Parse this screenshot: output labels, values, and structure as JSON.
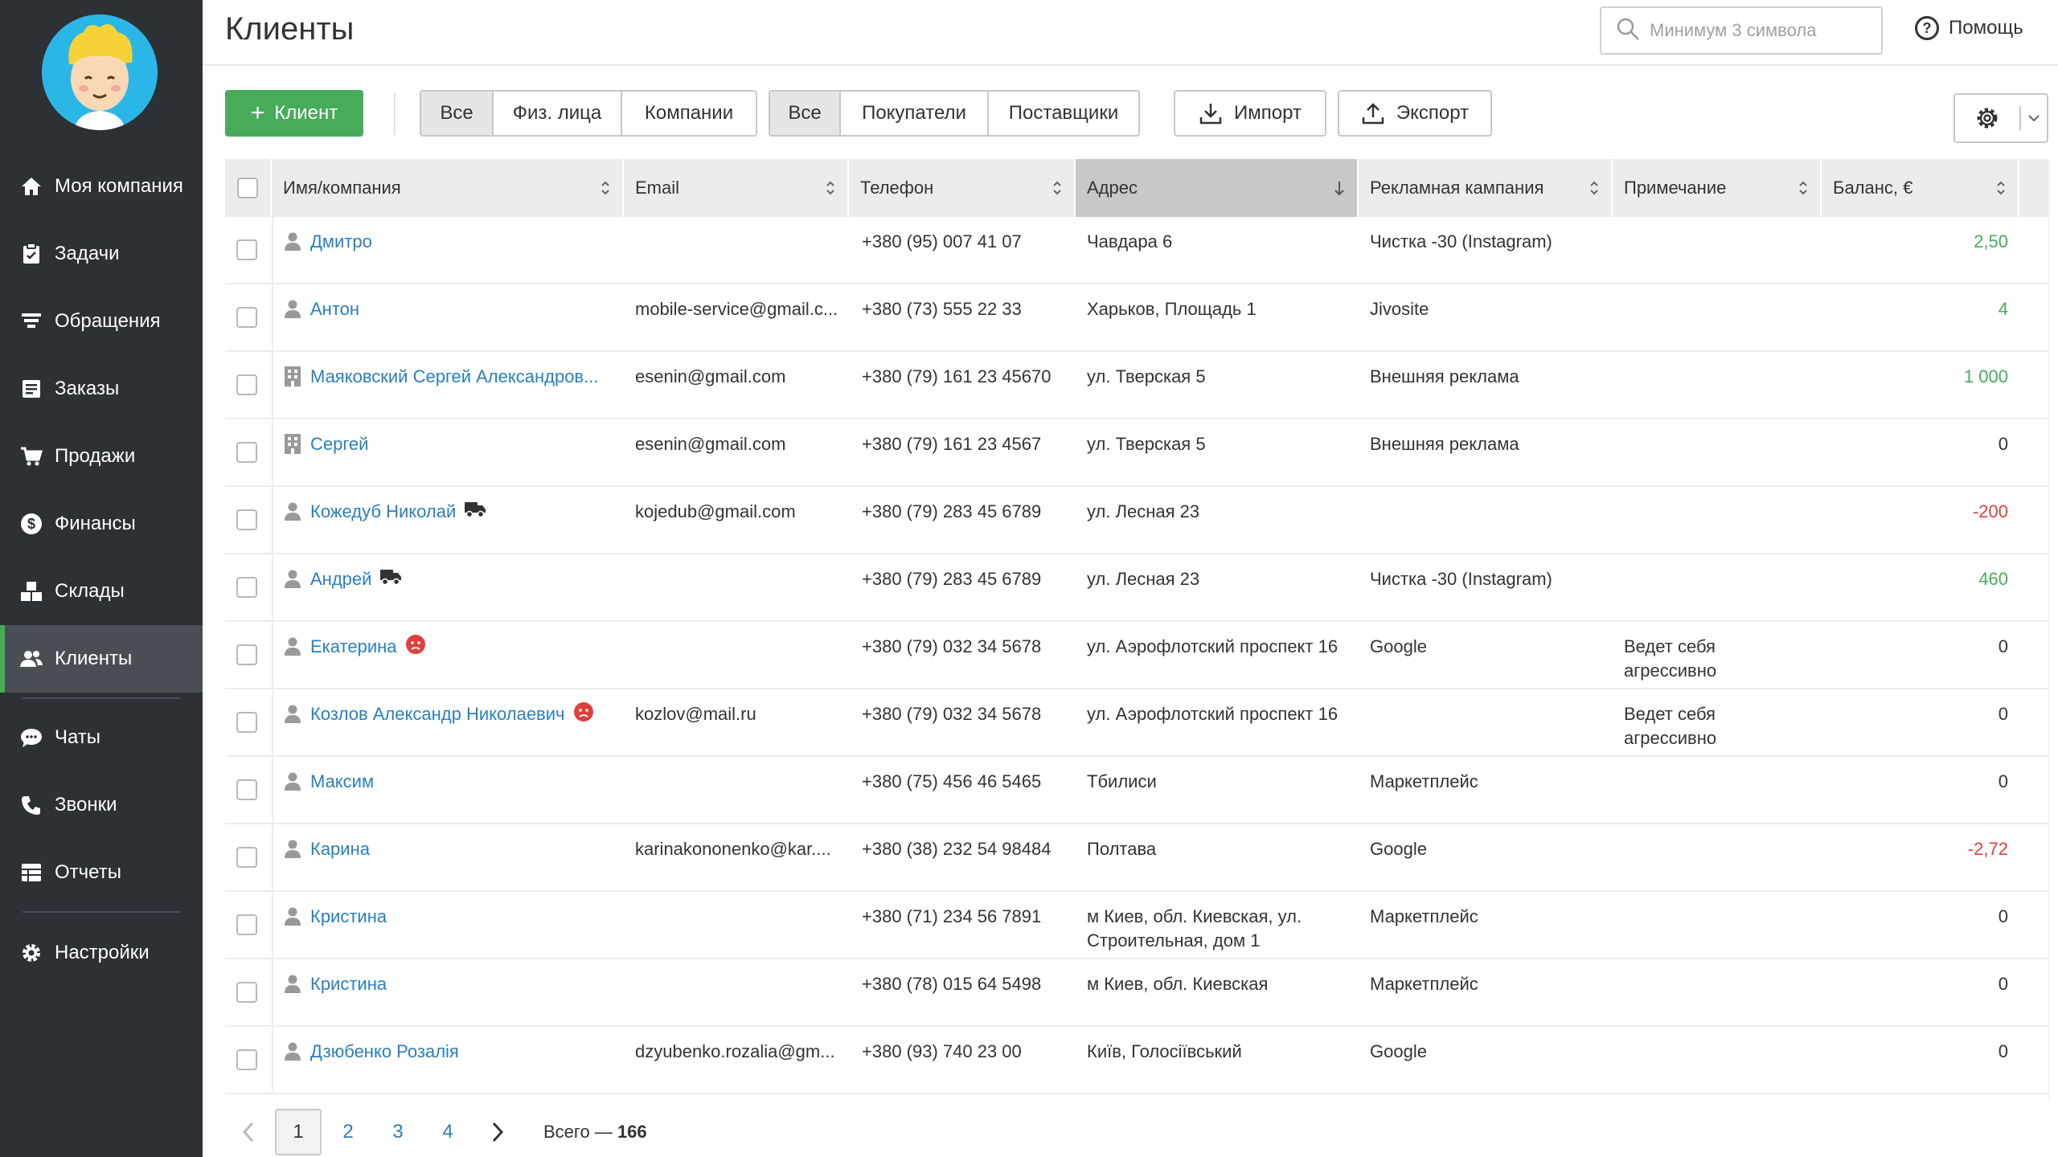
{
  "page_title": "Клиенты",
  "search": {
    "placeholder": "Минимум 3 символа"
  },
  "help_label": "Помощь",
  "sidebar": {
    "items": [
      {
        "label": "Моя компания",
        "icon": "home-icon"
      },
      {
        "label": "Задачи",
        "icon": "clipboard-icon"
      },
      {
        "label": "Обращения",
        "icon": "funnel-icon"
      },
      {
        "label": "Заказы",
        "icon": "order-icon"
      },
      {
        "label": "Продажи",
        "icon": "cart-icon"
      },
      {
        "label": "Финансы",
        "icon": "dollar-icon"
      },
      {
        "label": "Склады",
        "icon": "boxes-icon"
      },
      {
        "label": "Клиенты",
        "icon": "users-icon"
      },
      {
        "label": "Чаты",
        "icon": "chat-icon"
      },
      {
        "label": "Звонки",
        "icon": "phone-icon"
      },
      {
        "label": "Отчеты",
        "icon": "report-icon"
      },
      {
        "label": "Настройки",
        "icon": "gear-icon"
      }
    ],
    "active": "Клиенты"
  },
  "toolbar": {
    "add_label": "Клиент",
    "type_filter": [
      "Все",
      "Физ. лица",
      "Компании"
    ],
    "role_filter": [
      "Все",
      "Покупатели",
      "Поставщики"
    ],
    "import_label": "Импорт",
    "export_label": "Экспорт"
  },
  "table": {
    "columns": [
      "Имя/компания",
      "Email",
      "Телефон",
      "Адрес",
      "Рекламная кампания",
      "Примечание",
      "Баланс, €"
    ],
    "rows": [
      {
        "kind": "person",
        "name": "Дмитро",
        "email": "",
        "phone": "+380 (95) 007 41 07",
        "address": "Чавдара 6",
        "campaign": "Чистка -30 (Instagram)",
        "note": "",
        "balance": "2,50",
        "sign": "pos",
        "flag": ""
      },
      {
        "kind": "person",
        "name": "Антон",
        "email": "mobile-service@gmail.c...",
        "phone": "+380 (73) 555 22 33",
        "address": "Харьков, Площадь 1",
        "campaign": "Jivosite",
        "note": "",
        "balance": "4",
        "sign": "pos",
        "flag": ""
      },
      {
        "kind": "company",
        "name": "Маяковский Сергей Александров...",
        "email": "esenin@gmail.com",
        "phone": "+380 (79) 161 23 45670",
        "address": "ул. Тверская 5",
        "campaign": "Внешняя реклама",
        "note": "",
        "balance": "1 000",
        "sign": "pos",
        "flag": ""
      },
      {
        "kind": "company",
        "name": "Сергей",
        "email": "esenin@gmail.com",
        "phone": "+380 (79) 161 23 4567",
        "address": "ул. Тверская 5",
        "campaign": "Внешняя реклама",
        "note": "",
        "balance": "0",
        "sign": "zero",
        "flag": ""
      },
      {
        "kind": "person",
        "name": "Кожедуб Николай",
        "email": "kojedub@gmail.com",
        "phone": "+380 (79) 283 45 6789",
        "address": "ул. Лесная 23",
        "campaign": "",
        "note": "",
        "balance": "-200",
        "sign": "neg",
        "flag": "truck"
      },
      {
        "kind": "person",
        "name": "Андрей",
        "email": "",
        "phone": "+380 (79) 283 45 6789",
        "address": "ул. Лесная 23",
        "campaign": "Чистка -30 (Instagram)",
        "note": "",
        "balance": "460",
        "sign": "pos",
        "flag": "truck"
      },
      {
        "kind": "person",
        "name": "Екатерина",
        "email": "",
        "phone": "+380 (79) 032 34 5678",
        "address": "ул. Аэрофлотский проспект 16",
        "campaign": "Google",
        "note": "Ведет себя агрессивно",
        "balance": "0",
        "sign": "zero",
        "flag": "angry"
      },
      {
        "kind": "person",
        "name": "Козлов Александр Николаевич",
        "email": "kozlov@mail.ru",
        "phone": "+380 (79) 032 34 5678",
        "address": "ул. Аэрофлотский проспект 16",
        "campaign": "",
        "note": "Ведет себя агрессивно",
        "balance": "0",
        "sign": "zero",
        "flag": "angry"
      },
      {
        "kind": "person",
        "name": "Максим",
        "email": "",
        "phone": "+380 (75) 456 46 5465",
        "address": "Тбилиси",
        "campaign": "Маркетплейс",
        "note": "",
        "balance": "0",
        "sign": "zero",
        "flag": ""
      },
      {
        "kind": "person",
        "name": "Карина",
        "email": "karinakononenko@kar....",
        "phone": "+380 (38) 232 54 98484",
        "address": "Полтава",
        "campaign": "Google",
        "note": "",
        "balance": "-2,72",
        "sign": "neg",
        "flag": ""
      },
      {
        "kind": "person",
        "name": "Кристина",
        "email": "",
        "phone": "+380 (71) 234 56 7891",
        "address": "м Киев, обл. Киевская, ул. Строительная, дом 1",
        "campaign": "Маркетплейс",
        "note": "",
        "balance": "0",
        "sign": "zero",
        "flag": ""
      },
      {
        "kind": "person",
        "name": "Кристина",
        "email": "",
        "phone": "+380 (78) 015 64 5498",
        "address": "м Киев, обл. Киевская",
        "campaign": "Маркетплейс",
        "note": "",
        "balance": "0",
        "sign": "zero",
        "flag": ""
      },
      {
        "kind": "person",
        "name": "Дзюбенко Розалія",
        "email": "dzyubenko.rozalia@gm...",
        "phone": "+380 (93) 740 23 00",
        "address": "Київ, Голосіївський",
        "campaign": "Google",
        "note": "",
        "balance": "0",
        "sign": "zero",
        "flag": ""
      }
    ]
  },
  "pagination": {
    "pages": [
      "1",
      "2",
      "3",
      "4"
    ],
    "current": "1",
    "total_prefix": "Всего —",
    "total": "166"
  },
  "colors": {
    "accent": "#47ab5a",
    "link": "#2a7fc0",
    "negative": "#e0403c",
    "sidebar": "#2d3034"
  }
}
